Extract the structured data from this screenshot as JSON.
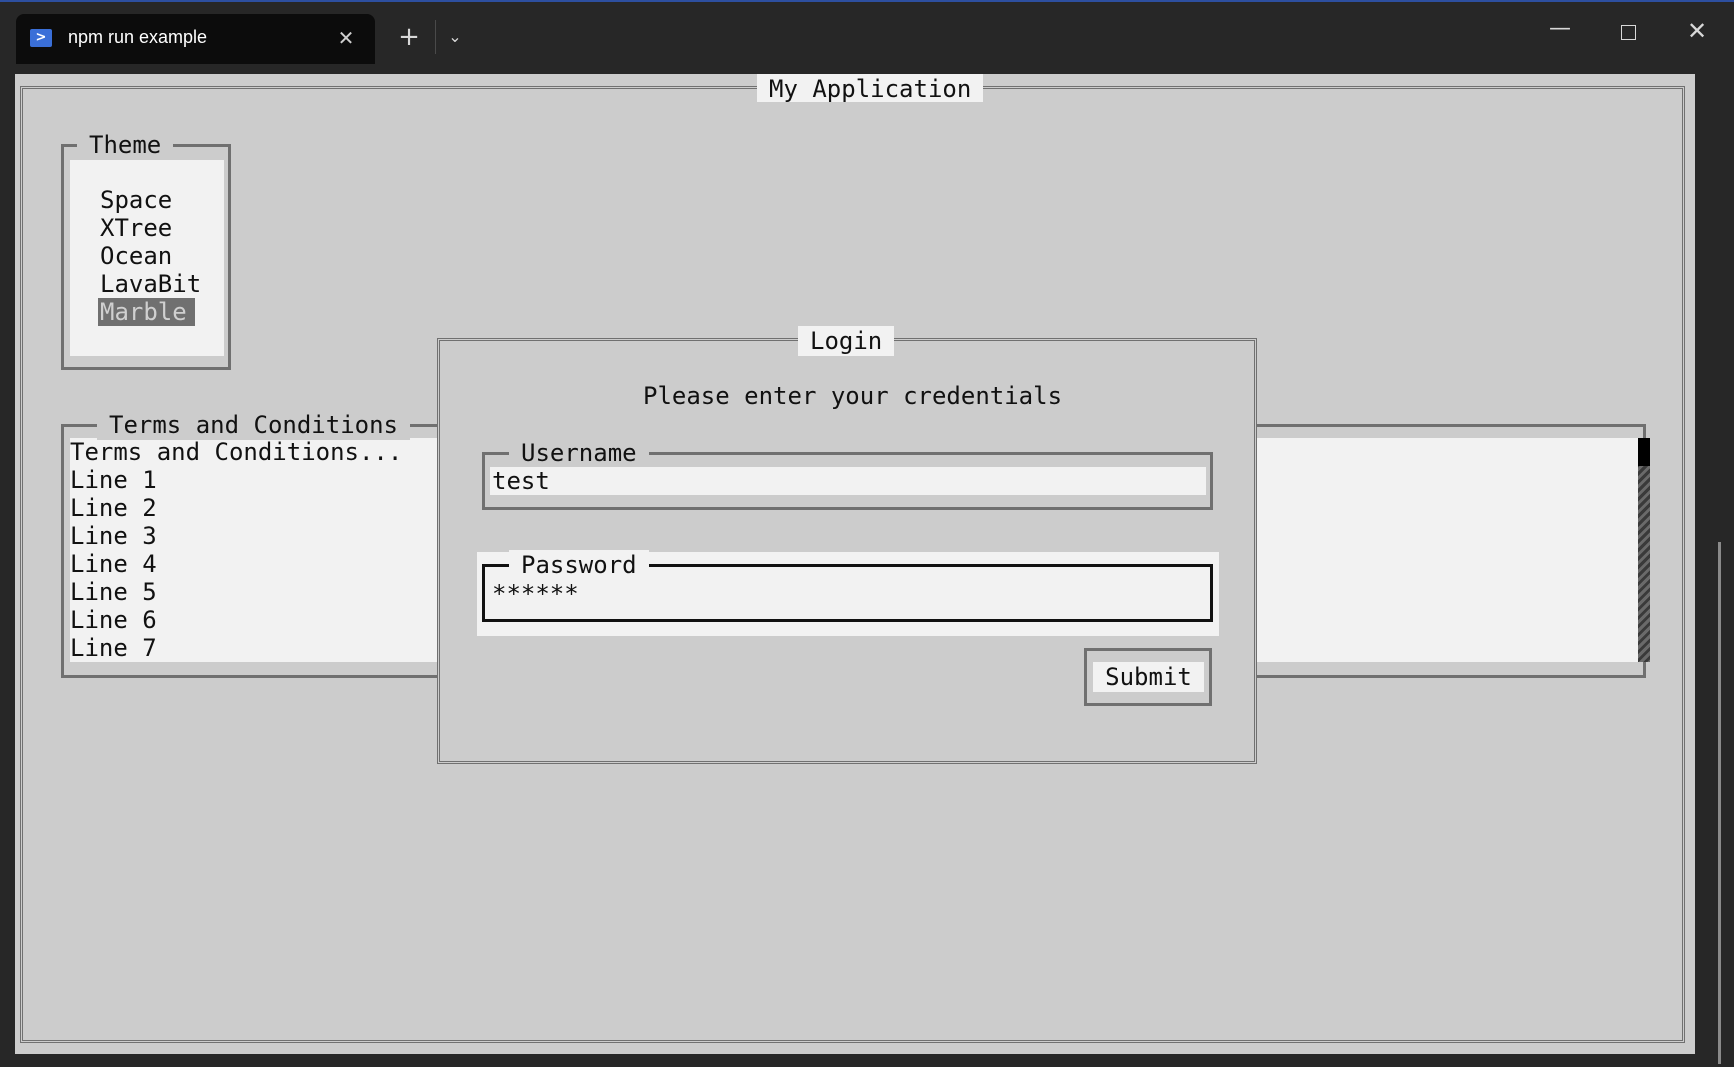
{
  "tab": {
    "title": "npm run example"
  },
  "app": {
    "title": "My Application"
  },
  "theme": {
    "label": "Theme",
    "items": [
      "Space",
      "XTree",
      "Ocean",
      "LavaBit",
      "Marble"
    ],
    "selected": "Marble"
  },
  "terms": {
    "label": "Terms and Conditions",
    "lines": [
      "Terms and Conditions...",
      "Line 1",
      "Line 2",
      "Line 3",
      "Line 4",
      "Line 5",
      "Line 6",
      "Line 7"
    ]
  },
  "login": {
    "title": "Login",
    "prompt": "Please enter your credentials",
    "username_label": "Username",
    "username_value": "test",
    "password_label": "Password",
    "password_value": "******",
    "submit_label": "Submit"
  },
  "icons": {
    "tab": "powershell-icon",
    "close_tab": "close-icon",
    "new_tab": "plus-icon",
    "dropdown": "chevron-down-icon",
    "minimize": "minimize-icon",
    "maximize": "maximize-icon",
    "close_window": "close-icon"
  }
}
